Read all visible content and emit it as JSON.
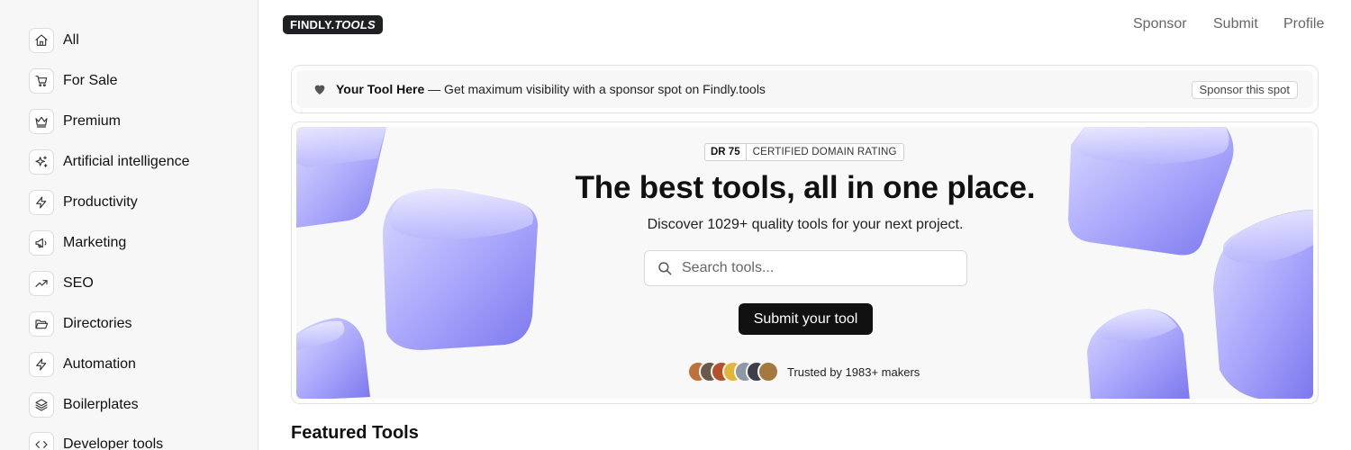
{
  "sidebar": {
    "items": [
      {
        "label": "All",
        "icon": "home-icon"
      },
      {
        "label": "For Sale",
        "icon": "cart-icon"
      },
      {
        "label": "Premium",
        "icon": "crown-icon"
      },
      {
        "label": "Artificial intelligence",
        "icon": "sparkles-icon"
      },
      {
        "label": "Productivity",
        "icon": "lightning-icon"
      },
      {
        "label": "Marketing",
        "icon": "megaphone-icon"
      },
      {
        "label": "SEO",
        "icon": "trending-up-icon"
      },
      {
        "label": "Directories",
        "icon": "folder-open-icon"
      },
      {
        "label": "Automation",
        "icon": "lightning-icon"
      },
      {
        "label": "Boilerplates",
        "icon": "layers-icon"
      },
      {
        "label": "Developer tools",
        "icon": "code-icon"
      }
    ]
  },
  "header": {
    "logo_main": "FINDLY.",
    "logo_accent": "TOOLS",
    "nav": [
      "Sponsor",
      "Submit",
      "Profile"
    ]
  },
  "sponsor_bar": {
    "highlight": "Your Tool Here",
    "text": " — Get maximum visibility with a sponsor spot on Findly.tools",
    "button": "Sponsor this spot"
  },
  "hero": {
    "badge_dr": "DR 75",
    "badge_text": "CERTIFIED DOMAIN RATING",
    "title": "The best tools, all in one place.",
    "subtitle": "Discover 1029+ quality tools for your next project.",
    "search_placeholder": "Search tools...",
    "submit_button": "Submit your tool",
    "trusted_text": "Trusted by 1983+ makers",
    "avatar_colors": [
      "#c0703a",
      "#6b5a4a",
      "#b5502c",
      "#e2b63a",
      "#8f98a6",
      "#3b3f4a",
      "#a3793f"
    ]
  },
  "main": {
    "section_title": "Featured Tools"
  },
  "colors": {
    "accent_cube": "#8a86f0",
    "button_dark": "#111111",
    "logo_bg": "#1f2024"
  }
}
